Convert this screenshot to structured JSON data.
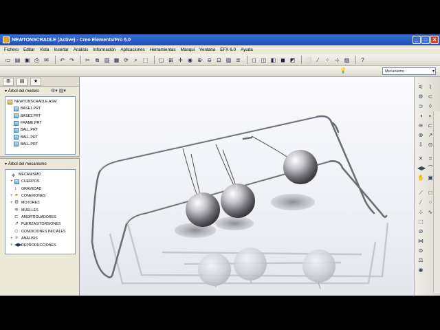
{
  "window": {
    "title": "NEWTONSCRADLE (Active) - Creo Elements/Pro 5.0"
  },
  "menu": [
    "Fichero",
    "Editar",
    "Vista",
    "Insertar",
    "Análisis",
    "Información",
    "Aplicaciones",
    "Herramientas",
    "Manqui",
    "Ventana",
    "EFX 6.0",
    "Ayuda"
  ],
  "toolbar": {
    "mode_select": "Mecanismo",
    "icons": [
      "new-icon",
      "open-icon",
      "save-icon",
      "print-icon",
      "email-icon",
      "undo-icon",
      "redo-icon",
      "cut-icon",
      "copy-icon",
      "paste-icon",
      "paste-special-icon",
      "regenerate-icon",
      "find-icon",
      "select-icon",
      "repaint-icon",
      "orient-icon",
      "spin-icon",
      "zoom-in-icon",
      "zoom-out-icon",
      "refit-icon",
      "view-manager-icon",
      "layers-icon",
      "wireframe-icon",
      "hidden-line-icon",
      "no-hidden-icon",
      "shading-icon",
      "help-icon"
    ]
  },
  "left_panel": {
    "model_tree_title": "Árbol del modelo",
    "model_tree": [
      "NEWTONSCRADLE.ASM",
      "BASE1.PRT",
      "BASE2.PRT",
      "FRAME.PRT",
      "BALL.PRT",
      "BALL.PRT",
      "BALL.PRT"
    ],
    "mechanism_tree_title": "Árbol del mecanismo",
    "mechanism_tree": [
      "MECANISMO",
      "CUERPOS",
      "GRAVEDAD",
      "CONEXIONES",
      "MOTORES",
      "MUELLES",
      "AMORTIGUADORES",
      "FUERZAS/TORSIONES",
      "CONDICIONES INICIALES",
      "ANÁLISIS",
      "REPRODUCCIONES"
    ]
  },
  "colors": {
    "title_bar": "#1e4fb5",
    "viewport_bg": "#f3f4f8",
    "tree_border": "#7f9db9"
  }
}
